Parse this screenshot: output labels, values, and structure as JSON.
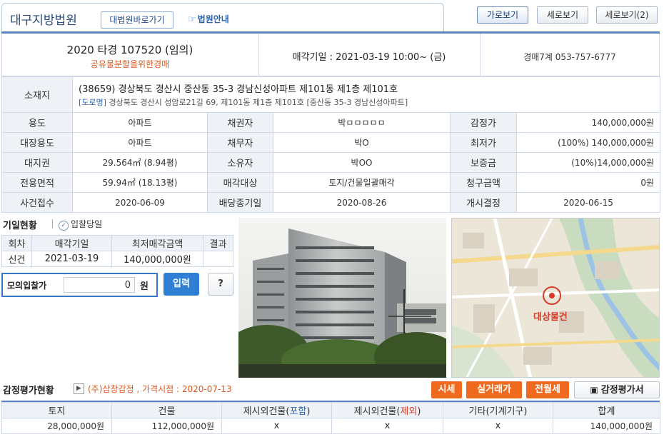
{
  "header": {
    "court_name": "대구지방법원",
    "court_link": "대법원바로가기",
    "guide_link": "법원안내",
    "view_buttons": [
      "가로보기",
      "세로보기",
      "세로보기(2)"
    ]
  },
  "case": {
    "number": "2020 타경 107520 (임의)",
    "type": "공유물분할을위한경매",
    "sale_date": "매각기일 : 2021-03-19 10:00~ (금)",
    "department": "경매7계 053-757-6777"
  },
  "property": {
    "address_label": "소재지",
    "address": "(38659) 경상북도 경산시 중산동 35-3 경남신성아파트 제101동 제1층 제101호",
    "road_tag": "[도로명]",
    "road_address": "경상북도 경산시 성암로21길 69, 제101동 제1층 제101호 [중산동 35-3 경남신성아파트]",
    "rows": [
      [
        "용도",
        "아파트",
        "채권자",
        "박ㅁㅁㅁㅁㅁ",
        "감정가",
        "140,000,000원"
      ],
      [
        "대장용도",
        "아파트",
        "채무자",
        "박O",
        "최저가",
        "(100%) 140,000,000원"
      ],
      [
        "대지권",
        "29.564㎡ (8.94평)",
        "소유자",
        "박OO",
        "보증금",
        "(10%)14,000,000원"
      ],
      [
        "전용면적",
        "59.94㎡ (18.13평)",
        "매각대상",
        "토지/건물일괄매각",
        "청구금액",
        "0원"
      ],
      [
        "사건접수",
        "2020-06-09",
        "배당종기일",
        "2020-08-26",
        "개시결정",
        "2020-06-15"
      ]
    ]
  },
  "history": {
    "title": "기일현황",
    "bid_day": "입찰당일",
    "headers": [
      "회차",
      "매각기일",
      "최저매각금액",
      "결과"
    ],
    "rows": [
      [
        "신건",
        "2021-03-19",
        "140,000,000원",
        ""
      ]
    ]
  },
  "mock_bid": {
    "label": "모의입찰가",
    "value": "0",
    "unit": "원",
    "submit": "입력",
    "help": "?"
  },
  "map": {
    "marker_label": "대상물건"
  },
  "appraisal": {
    "title": "감정평가현황",
    "info": "(주)삼창감정 , 가격시점 : 2020-07-13",
    "buttons": [
      "시세",
      "실거래가",
      "전월세"
    ],
    "report_button": "감정평가서",
    "headers": [
      "토지",
      "건물",
      "제시외건물(포함)",
      "제시외건물(제외)",
      "기타(기계기구)",
      "합계"
    ],
    "values": [
      "28,000,000원",
      "112,000,000원",
      "x",
      "x",
      "x",
      "140,000,000원"
    ]
  },
  "colors": {
    "accent_blue": "#5b85c4",
    "orange": "#ef6a1f",
    "red_text": "#d23c2a"
  }
}
